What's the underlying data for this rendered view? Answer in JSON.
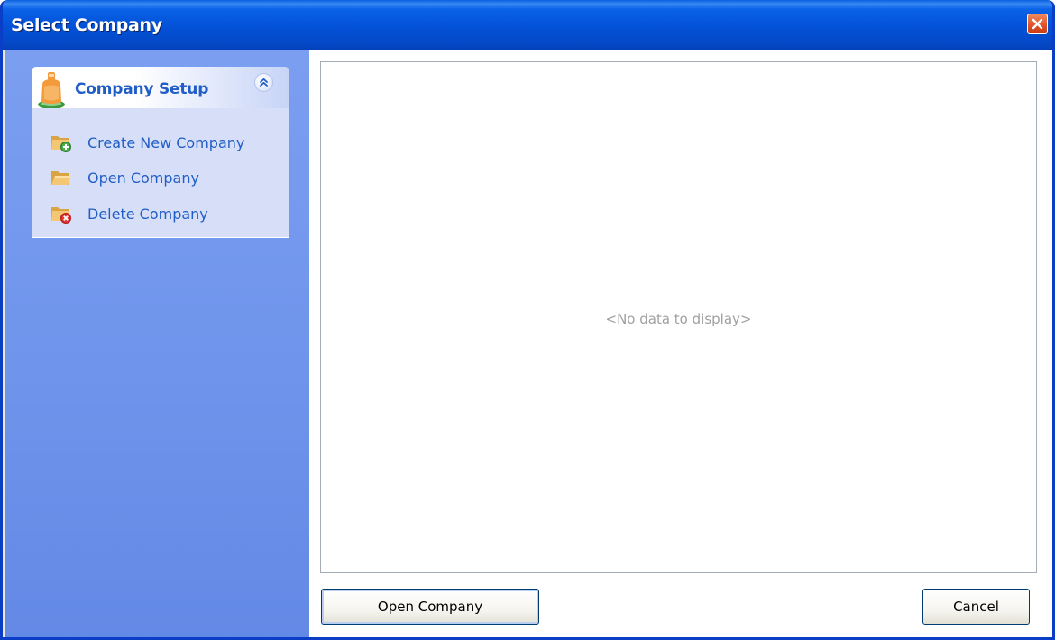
{
  "window": {
    "title": "Select Company",
    "close_icon": "close-icon"
  },
  "sidebar": {
    "panel": {
      "title": "Company Setup",
      "icon": "company-icon",
      "collapse_icon": "chevron-double-up-icon",
      "tasks": [
        {
          "label": "Create New Company",
          "icon": "folder-add-icon"
        },
        {
          "label": "Open Company",
          "icon": "folder-open-icon"
        },
        {
          "label": "Delete Company",
          "icon": "folder-delete-icon"
        }
      ]
    }
  },
  "main": {
    "empty_message": "<No data to display>"
  },
  "footer": {
    "open_label": "Open Company",
    "cancel_label": "Cancel"
  },
  "colors": {
    "titlebar": "#0352d8",
    "sidebar": "#6f95ec",
    "link": "#215dc6",
    "panel_body": "#d6dff7"
  }
}
